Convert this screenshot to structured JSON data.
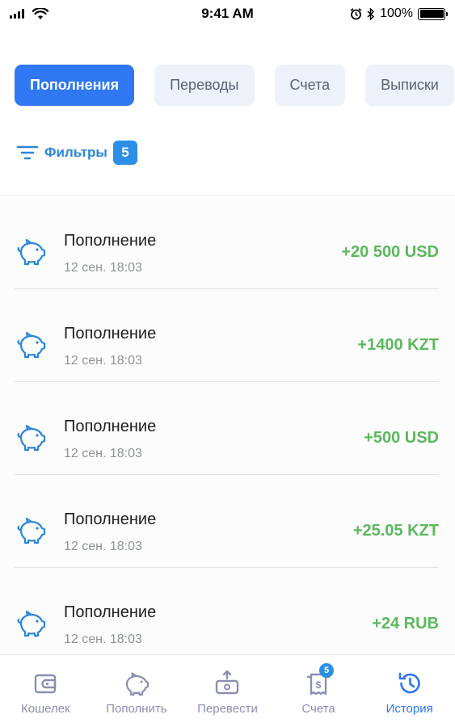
{
  "status_bar": {
    "time": "9:41 AM",
    "battery": "100%"
  },
  "tabs": [
    {
      "label": "Пополнения",
      "active": true
    },
    {
      "label": "Переводы",
      "active": false
    },
    {
      "label": "Счета",
      "active": false
    },
    {
      "label": "Выписки",
      "active": false
    }
  ],
  "filters": {
    "label": "Фильтры",
    "count": "5"
  },
  "transactions": [
    {
      "title": "Пополнение",
      "date": "12 сен. 18:03",
      "amount": "+20 500 USD",
      "icon": "piggy-bank-icon"
    },
    {
      "title": "Пополнение",
      "date": "12 сен. 18:03",
      "amount": "+1400 KZT",
      "icon": "piggy-bank-icon"
    },
    {
      "title": "Пополнение",
      "date": "12 сен. 18:03",
      "amount": "+500 USD",
      "icon": "piggy-bank-icon"
    },
    {
      "title": "Пополнение",
      "date": "12 сен. 18:03",
      "amount": "+25.05 KZT",
      "icon": "piggy-bank-icon"
    },
    {
      "title": "Пополнение",
      "date": "12 сен. 18:03",
      "amount": "+24 RUB",
      "icon": "piggy-bank-icon"
    }
  ],
  "bottom_nav": [
    {
      "label": "Кошелек",
      "icon": "wallet-icon",
      "active": false
    },
    {
      "label": "Пополнить",
      "icon": "piggy-bank-icon",
      "active": false
    },
    {
      "label": "Перевести",
      "icon": "transfer-icon",
      "active": false
    },
    {
      "label": "Счета",
      "icon": "invoice-icon",
      "active": false,
      "badge": "5"
    },
    {
      "label": "История",
      "icon": "history-icon",
      "active": true
    }
  ],
  "colors": {
    "accent": "#2f77f3",
    "positive_amount": "#5cb85c",
    "filter_blue": "#2a86d9",
    "nav_inactive": "#8a8fb3"
  }
}
